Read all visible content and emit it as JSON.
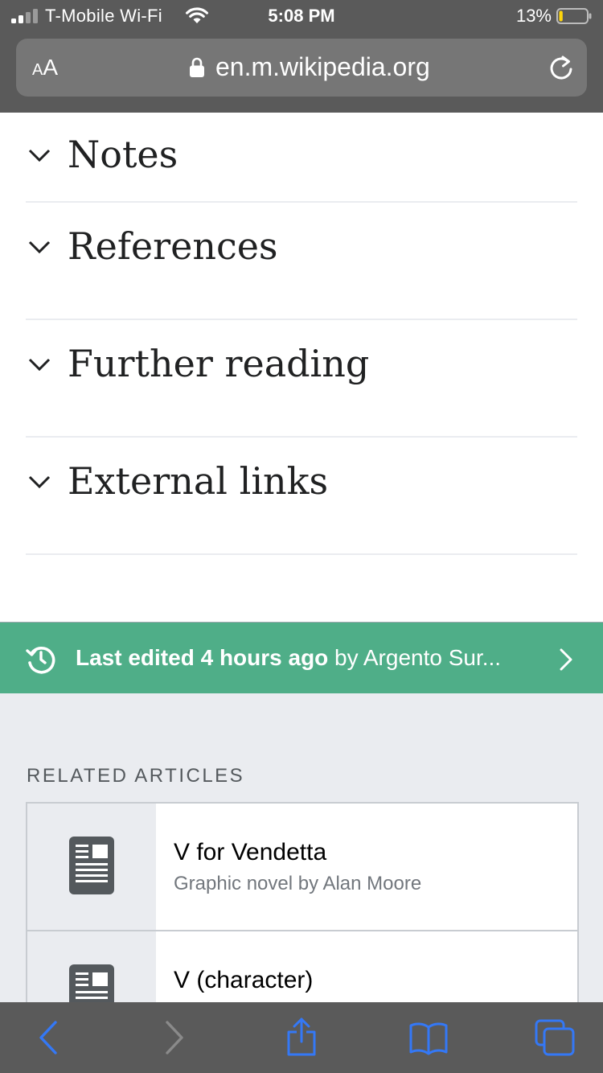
{
  "status_bar": {
    "carrier": "T-Mobile Wi-Fi",
    "time": "5:08 PM",
    "battery_percent": "13%",
    "battery_level": 0.13,
    "battery_color": "#ffd60a"
  },
  "url_bar": {
    "text_size_label": "AA",
    "url": "en.m.wikipedia.org"
  },
  "sections": [
    {
      "title": "Notes"
    },
    {
      "title": "References"
    },
    {
      "title": "Further reading"
    },
    {
      "title": "External links"
    }
  ],
  "last_edited": {
    "label": "Last edited 4 hours ago",
    "by_text": " by Argento Sur...",
    "color": "#4fae88"
  },
  "related": {
    "heading": "RELATED ARTICLES",
    "items": [
      {
        "title": "V for Vendetta",
        "description": "Graphic novel by Alan Moore"
      },
      {
        "title": "V (character)",
        "description": ""
      }
    ]
  },
  "toolbar": {
    "accent": "#3478f6",
    "icons": [
      "back-icon",
      "forward-icon",
      "share-icon",
      "bookmarks-icon",
      "tabs-icon"
    ]
  }
}
